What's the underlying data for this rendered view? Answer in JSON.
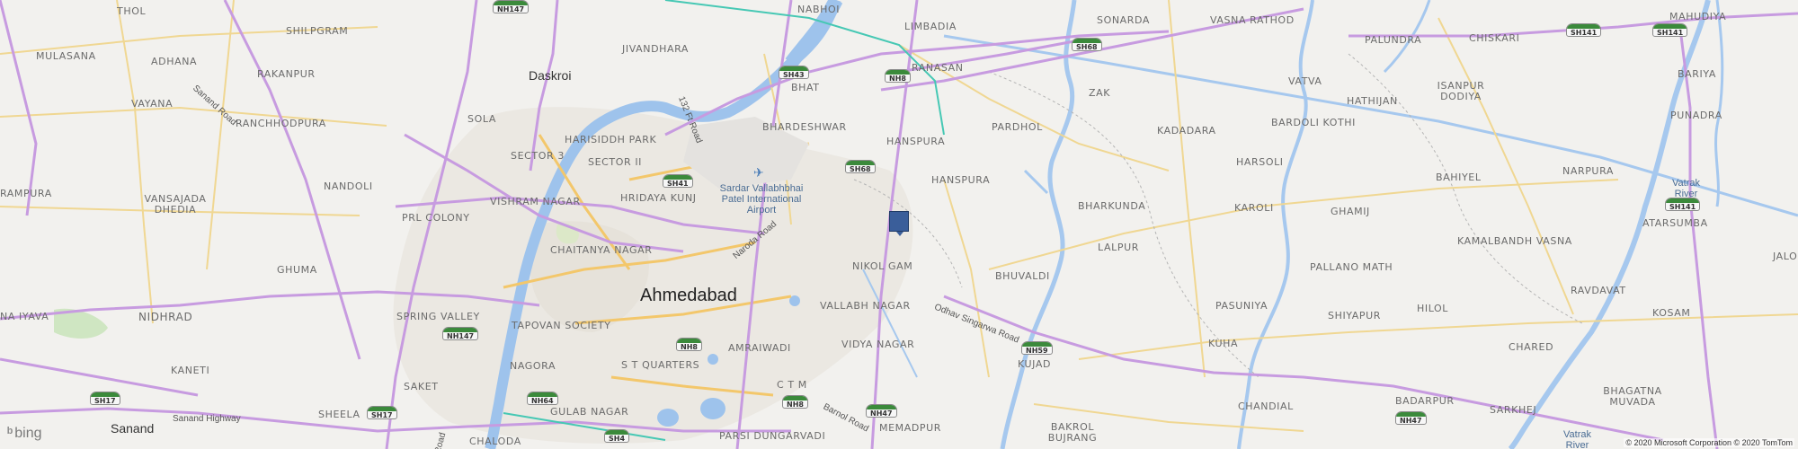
{
  "map": {
    "places": [
      {
        "id": "thol",
        "name": "THOL"
      },
      {
        "id": "shilpgram",
        "name": "SHILPGRAM"
      },
      {
        "id": "mulasana",
        "name": "MULASANA"
      },
      {
        "id": "adhana",
        "name": "ADHANA"
      },
      {
        "id": "rakanpur",
        "name": "RAKANPUR"
      },
      {
        "id": "vayana",
        "name": "VAYANA"
      },
      {
        "id": "ranchhodpura",
        "name": "RANCHHODPURA"
      },
      {
        "id": "sola",
        "name": "SOLA"
      },
      {
        "id": "harisiddh-park",
        "name": "HARISIDDH PARK"
      },
      {
        "id": "sector-3",
        "name": "SECTOR 3"
      },
      {
        "id": "sector-ii",
        "name": "SECTOR II"
      },
      {
        "id": "nandoli",
        "name": "NANDOLI"
      },
      {
        "id": "vishram-nagar",
        "name": "VISHRAM NAGAR"
      },
      {
        "id": "hridaya-kunj",
        "name": "HRIDAYA KUNJ"
      },
      {
        "id": "vansajada-dhedia",
        "name": "VANSAJADA DHEDIA"
      },
      {
        "id": "rampura",
        "name": "RAMPURA"
      },
      {
        "id": "prl-colony",
        "name": "PRL COLONY"
      },
      {
        "id": "chaitanya-nagar",
        "name": "CHAITANYA NAGAR"
      },
      {
        "id": "ghuma",
        "name": "GHUMA"
      },
      {
        "id": "spring-valley",
        "name": "SPRING VALLEY"
      },
      {
        "id": "tapovan-society",
        "name": "TAPOVAN SOCIETY"
      },
      {
        "id": "nidhrad",
        "name": "NIDHRAD"
      },
      {
        "id": "na-iyava",
        "name": "NA IYAVA"
      },
      {
        "id": "kaneti",
        "name": "KANETI"
      },
      {
        "id": "nagora",
        "name": "NAGORA"
      },
      {
        "id": "saket",
        "name": "SAKET"
      },
      {
        "id": "st-quarters",
        "name": "S T QUARTERS"
      },
      {
        "id": "amraiwadi",
        "name": "AMRAIWADI"
      },
      {
        "id": "sheela",
        "name": "SHEELA"
      },
      {
        "id": "gulab-nagar",
        "name": "GULAB NAGAR"
      },
      {
        "id": "chaloda",
        "name": "CHALODA"
      },
      {
        "id": "ctm",
        "name": "C T M"
      },
      {
        "id": "parsi-dungarvadi",
        "name": "PARSI DUNGARVADI"
      },
      {
        "id": "jivandhara",
        "name": "JIVANDHARA"
      },
      {
        "id": "nabhoi",
        "name": "NABHOI"
      },
      {
        "id": "bhat",
        "name": "BHAT"
      },
      {
        "id": "limbadia",
        "name": "LIMBADIA"
      },
      {
        "id": "ranasan",
        "name": "RANASAN"
      },
      {
        "id": "bhardeshwar",
        "name": "BHARDESHWAR"
      },
      {
        "id": "hanspura-1",
        "name": "HANSPURA"
      },
      {
        "id": "hanspura-2",
        "name": "HANSPURA"
      },
      {
        "id": "pardhol",
        "name": "PARDHOL"
      },
      {
        "id": "nikol-gam",
        "name": "NIKOL GAM"
      },
      {
        "id": "vallabh-nagar",
        "name": "VALLABH NAGAR"
      },
      {
        "id": "vidya-nagar",
        "name": "VIDYA NAGAR"
      },
      {
        "id": "bhuvaldi",
        "name": "BHUVALDI"
      },
      {
        "id": "kujad",
        "name": "KUJAD"
      },
      {
        "id": "memadpur",
        "name": "MEMADPUR"
      },
      {
        "id": "bakrol-bujrang",
        "name": "BAKROL BUJRANG"
      },
      {
        "id": "sonarda",
        "name": "SONARDA"
      },
      {
        "id": "zak",
        "name": "ZAK"
      },
      {
        "id": "vasna-rathod",
        "name": "VASNA RATHOD"
      },
      {
        "id": "kadadara",
        "name": "KADADARA"
      },
      {
        "id": "bharkunda",
        "name": "BHARKUNDA"
      },
      {
        "id": "lalpur",
        "name": "LALPUR"
      },
      {
        "id": "harsoli",
        "name": "HARSOLI"
      },
      {
        "id": "karoli",
        "name": "KAROLI"
      },
      {
        "id": "pasuniya",
        "name": "PASUNIYA"
      },
      {
        "id": "kuha",
        "name": "KUHA"
      },
      {
        "id": "chandial",
        "name": "CHANDIAL"
      },
      {
        "id": "vatva",
        "name": "VATVA"
      },
      {
        "id": "palundra",
        "name": "PALUNDRA"
      },
      {
        "id": "chiskari",
        "name": "CHISKARI"
      },
      {
        "id": "isanpur-dodiya",
        "name": "ISANPUR DODIYA"
      },
      {
        "id": "hathijan",
        "name": "HATHIJAN"
      },
      {
        "id": "bardoli-kothi",
        "name": "BARDOLI KOTHI"
      },
      {
        "id": "bahiyel",
        "name": "BAHIYEL"
      },
      {
        "id": "ghamij",
        "name": "GHAMIJ"
      },
      {
        "id": "pallano-math",
        "name": "PALLANO MATH"
      },
      {
        "id": "kamalbandh-vasna",
        "name": "KAMALBANDH VASNA"
      },
      {
        "id": "shiyapur",
        "name": "SHIYAPUR"
      },
      {
        "id": "hilol",
        "name": "HILOL"
      },
      {
        "id": "badarpur",
        "name": "BADARPUR"
      },
      {
        "id": "chared",
        "name": "CHARED"
      },
      {
        "id": "sarkhej",
        "name": "SARKHEJ"
      },
      {
        "id": "bhagatna-muvada",
        "name": "BHAGATNA MUVADA"
      },
      {
        "id": "mahudiya",
        "name": "MAHUDIYA"
      },
      {
        "id": "bariya",
        "name": "BARIYA"
      },
      {
        "id": "punadra",
        "name": "PUNADRA"
      },
      {
        "id": "narpura",
        "name": "NARPURA"
      },
      {
        "id": "atarsumba",
        "name": "ATARSUMBA"
      },
      {
        "id": "ravdavat",
        "name": "RAVDAVAT"
      },
      {
        "id": "kosam",
        "name": "KOSAM"
      },
      {
        "id": "jalo",
        "name": "JALO"
      }
    ],
    "cities": [
      {
        "id": "daskroi",
        "name": "Daskroi"
      },
      {
        "id": "sanand",
        "name": "Sanand"
      }
    ],
    "major_city": {
      "name": "Ahmedabad"
    },
    "roads": [
      {
        "id": "sanand-road",
        "name": "Sanand Road"
      },
      {
        "id": "132-ft-road",
        "name": "132 Ft Road"
      },
      {
        "id": "naroda-road",
        "name": "Naroda Road"
      },
      {
        "id": "odhav-singarwa-road",
        "name": "Odhav Singarwa Road"
      },
      {
        "id": "sanand-highway",
        "name": "Sanand Highway"
      },
      {
        "id": "barnol-road",
        "name": "Barnol Road"
      },
      {
        "id": "road-frag",
        "name": "Road"
      }
    ],
    "shields": [
      {
        "id": "nh147-top",
        "label": "NH147"
      },
      {
        "id": "sh43",
        "label": "SH43"
      },
      {
        "id": "nh8-top",
        "label": "NH8"
      },
      {
        "id": "sh68-a",
        "label": "SH68"
      },
      {
        "id": "sh68-b",
        "label": "SH68"
      },
      {
        "id": "sh41",
        "label": "SH41"
      },
      {
        "id": "nh147-left",
        "label": "NH147"
      },
      {
        "id": "nh8-mid",
        "label": "NH8"
      },
      {
        "id": "nh59",
        "label": "NH59"
      },
      {
        "id": "sh17-a",
        "label": "SH17"
      },
      {
        "id": "sh17-b",
        "label": "SH17"
      },
      {
        "id": "nh64",
        "label": "NH64"
      },
      {
        "id": "nh8-bot",
        "label": "NH8"
      },
      {
        "id": "nh47-bot",
        "label": "NH47"
      },
      {
        "id": "sh4",
        "label": "SH4"
      },
      {
        "id": "nh47-right",
        "label": "NH47"
      },
      {
        "id": "sh141-a",
        "label": "SH141"
      },
      {
        "id": "sh141-b",
        "label": "SH141"
      },
      {
        "id": "sh141-c",
        "label": "SH141"
      }
    ],
    "airport": {
      "name": "Sardar Vallabhbhai Patel International Airport",
      "lines": [
        "Sardar Vallabhbhai",
        "Patel International",
        "Airport"
      ]
    },
    "rivers": [
      {
        "id": "vatrak-1",
        "lines": [
          "Vatrak",
          "River"
        ]
      },
      {
        "id": "vatrak-2",
        "lines": [
          "Vatrak",
          "River"
        ]
      }
    ],
    "marker": {
      "label": "location-pin",
      "color": "#3a5e9a"
    },
    "colors": {
      "background": "#f2f1ee",
      "highway": "#c79be0",
      "road": "#f3d27a",
      "water": "#9ec3ec",
      "shield_top": "#3b8a3b",
      "rail": "#46c8b4"
    }
  },
  "attribution": {
    "logo_text": "bing",
    "copyright": "© 2020 Microsoft Corporation © 2020 TomTom"
  }
}
